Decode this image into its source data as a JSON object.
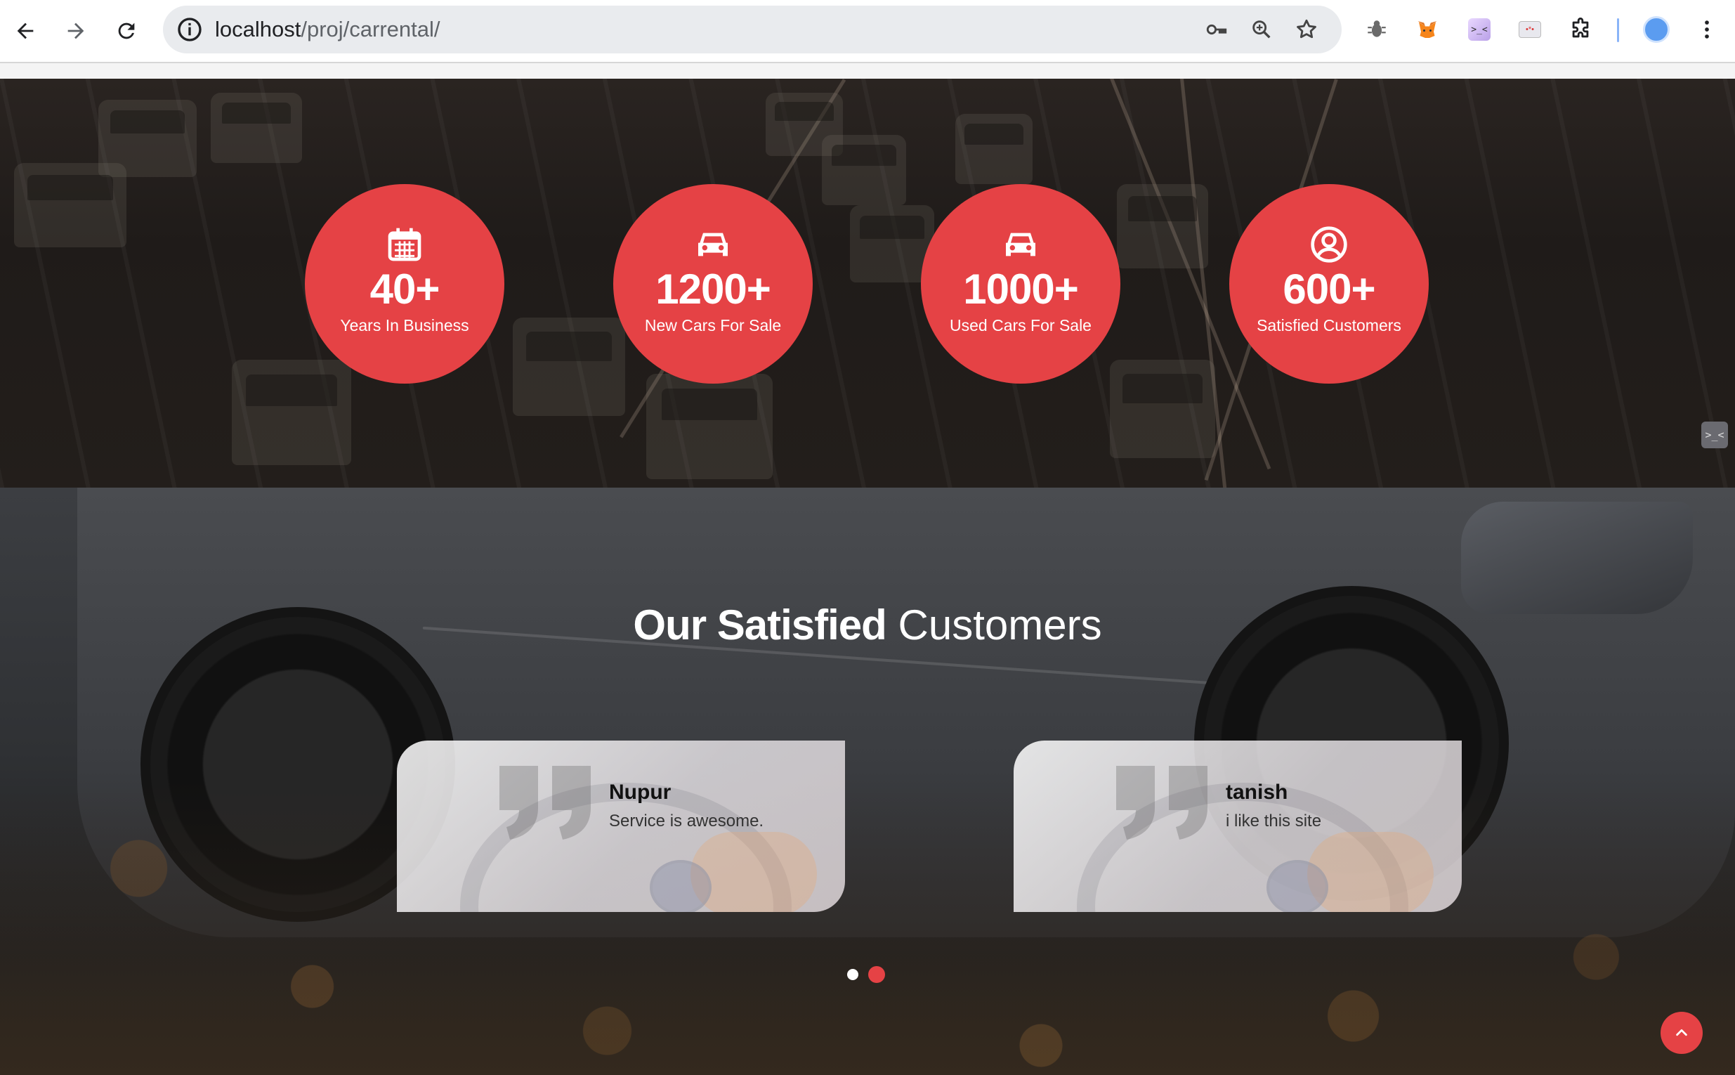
{
  "browser": {
    "url_host": "localhost",
    "url_path": "/proj/carrental/",
    "extensions": [
      "bug-extension-icon",
      "metamask-fox-icon",
      "devtools-extension-icon",
      "card-extension-icon",
      "extensions-puzzle-icon",
      "profile-avatar-icon"
    ]
  },
  "stats": [
    {
      "icon": "calendar-icon",
      "number": "40+",
      "label": "Years In Business"
    },
    {
      "icon": "car-icon",
      "number": "1200+",
      "label": "New Cars For Sale"
    },
    {
      "icon": "car-icon",
      "number": "1000+",
      "label": "Used Cars For Sale"
    },
    {
      "icon": "user-circle-icon",
      "number": "600+",
      "label": "Satisfied Customers"
    }
  ],
  "side_tab": {
    "label": ">_<"
  },
  "testimonials": {
    "title_strong": "Our Satisfied",
    "title_light": " Customers",
    "cards": [
      {
        "name": "Nupur",
        "text": "Service is awesome."
      },
      {
        "name": "tanish",
        "text": "i like this site"
      }
    ],
    "pagination": {
      "count": 2,
      "active": 2
    }
  },
  "colors": {
    "accent": "#e54245",
    "chrome_bg": "#ffffff",
    "omnibox_bg": "#e9ebee"
  }
}
